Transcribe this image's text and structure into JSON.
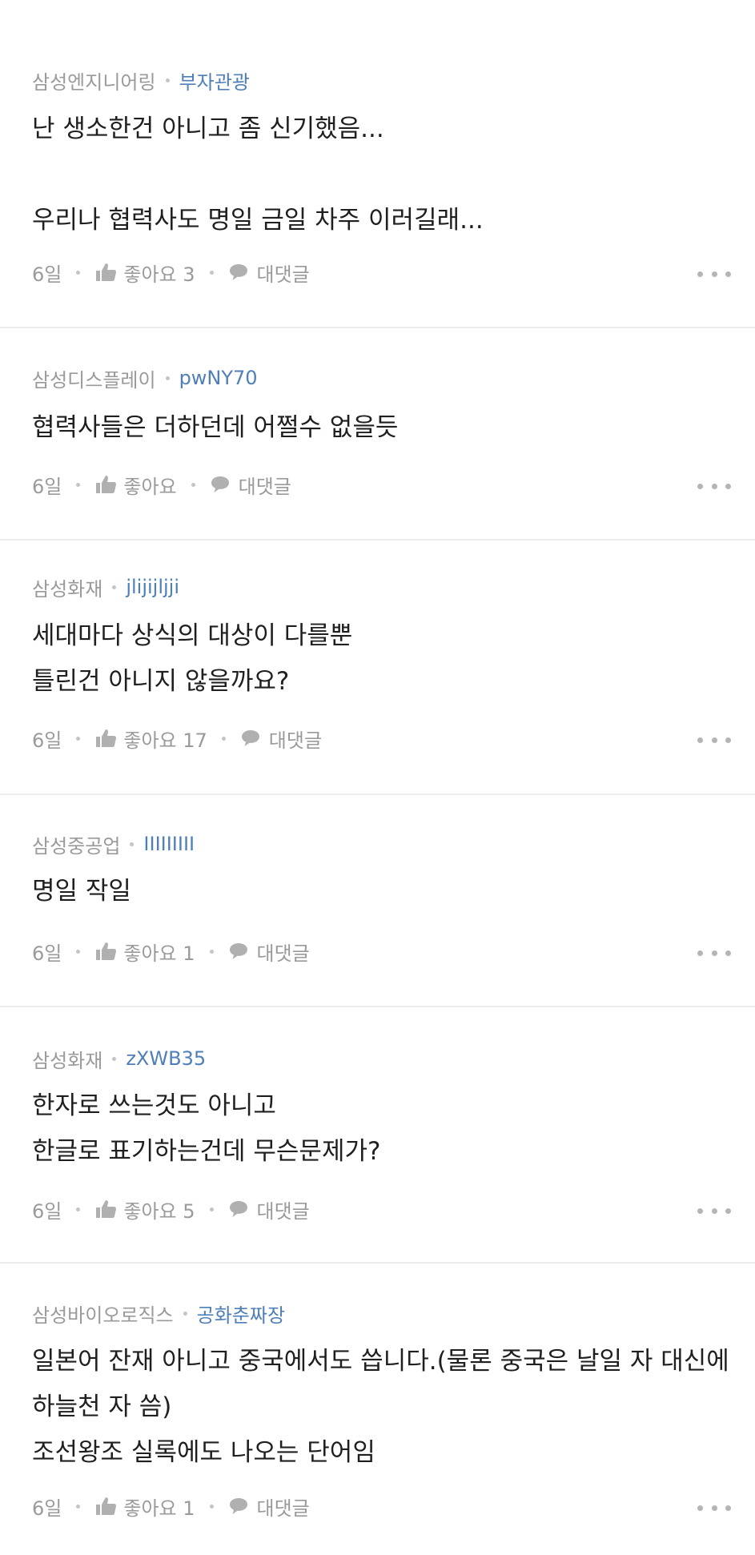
{
  "comments": [
    {
      "company": "삼성엔지니어링",
      "nickname": "부자관광",
      "text": "난 생소한건 아니고 좀 신기했음...\n\n우리나 협력사도 명일 금일 차주 이러길래...",
      "time": "6일",
      "likes_label": "좋아요 3",
      "reply_label": "대댓글"
    },
    {
      "company": "삼성디스플레이",
      "nickname": "pwNY70",
      "text": "협력사들은 더하던데 어쩔수 없을듯",
      "time": "6일",
      "likes_label": "좋아요",
      "reply_label": "대댓글"
    },
    {
      "company": "삼성화재",
      "nickname": "jlijijljji",
      "text": "세대마다 상식의 대상이 다를뿐\n틀린건 아니지 않을까요?",
      "time": "6일",
      "likes_label": "좋아요 17",
      "reply_label": "대댓글"
    },
    {
      "company": "삼성중공업",
      "nickname": "IIIIIIIII",
      "text": "명일 작일",
      "time": "6일",
      "likes_label": "좋아요 1",
      "reply_label": "대댓글"
    },
    {
      "company": "삼성화재",
      "nickname": "zXWB35",
      "text": "한자로 쓰는것도 아니고\n한글로 표기하는건데 무슨문제가?",
      "time": "6일",
      "likes_label": "좋아요 5",
      "reply_label": "대댓글"
    },
    {
      "company": "삼성바이오로직스",
      "nickname": "공화춘짜장",
      "text": "일본어 잔재 아니고 중국에서도 씁니다.(물론 중국은 날일 자 대신에\n하늘천 자 씀)\n조선왕조 실록에도 나오는 단어임",
      "time": "6일",
      "likes_label": "좋아요 1",
      "reply_label": "대댓글"
    }
  ],
  "icons": {
    "like": "thumbs-up-icon",
    "reply": "speech-bubble-icon",
    "more": "more-dots-icon"
  },
  "colors": {
    "nickname": "#4f7fb8",
    "meta": "#9a9a9a",
    "divider": "#ececec"
  }
}
